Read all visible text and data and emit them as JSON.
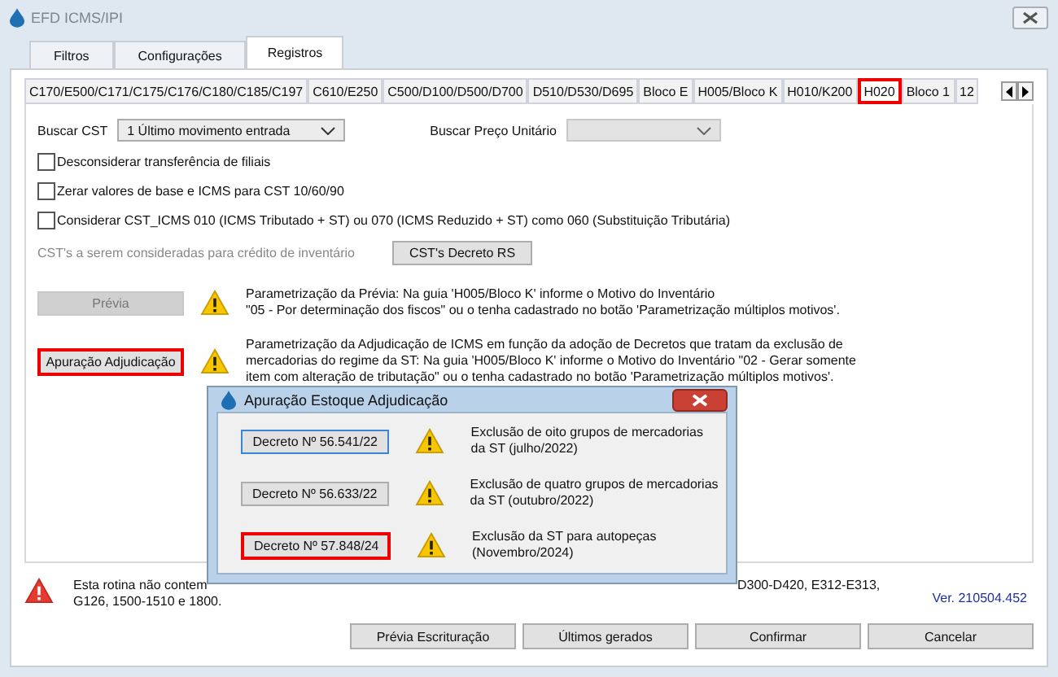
{
  "window": {
    "title": "EFD ICMS/IPI"
  },
  "tabs": [
    {
      "label": "Filtros",
      "selected": false
    },
    {
      "label": "Configurações",
      "selected": false
    },
    {
      "label": "Registros",
      "selected": true
    }
  ],
  "subtabs": [
    {
      "label": "C170/E500/C171/C175/C176/C180/C185/C197",
      "selected": false,
      "highlighted": false
    },
    {
      "label": "C610/E250",
      "selected": false,
      "highlighted": false
    },
    {
      "label": "C500/D100/D500/D700",
      "selected": false,
      "highlighted": false
    },
    {
      "label": "D510/D530/D695",
      "selected": false,
      "highlighted": false
    },
    {
      "label": "Bloco E",
      "selected": false,
      "highlighted": false
    },
    {
      "label": "H005/Bloco K",
      "selected": false,
      "highlighted": false
    },
    {
      "label": "H010/K200",
      "selected": false,
      "highlighted": false
    },
    {
      "label": "H020",
      "selected": true,
      "highlighted": true
    },
    {
      "label": "Bloco 1",
      "selected": false,
      "highlighted": false
    },
    {
      "label": "12",
      "selected": false,
      "highlighted": false
    }
  ],
  "buscar_cst": {
    "label": "Buscar CST",
    "value": "1 Último movimento entrada"
  },
  "buscar_preco": {
    "label": "Buscar Preço Unitário",
    "disabled": true
  },
  "checkboxes": [
    {
      "label": "Desconsiderar transferência de filiais",
      "checked": false
    },
    {
      "label": "Zerar valores de base e ICMS para CST 10/60/90",
      "checked": false
    },
    {
      "label": "Considerar CST_ICMS 010 (ICMS Tributado + ST) ou 070 (ICMS Reduzido + ST) como 060 (Substituição Tributária)",
      "checked": false
    }
  ],
  "cst_credito": {
    "label": "CST's a serem consideradas para crédito de inventário",
    "button": "CST's Decreto RS"
  },
  "actions": [
    {
      "button": "Prévia",
      "disabled": true,
      "highlighted": false,
      "lines": [
        "Parametrização da Prévia: Na guia 'H005/Bloco K' informe o Motivo do Inventário",
        "\"05 - Por determinação dos fiscos\" ou o tenha cadastrado no botão 'Parametrização múltiplos motivos'."
      ]
    },
    {
      "button": "Apuração Adjudicação",
      "disabled": false,
      "highlighted": true,
      "lines": [
        "Parametrização da Adjudicação de ICMS em função da adoção de Decretos que tratam da exclusão de",
        "mercadorias do regime da ST: Na guia 'H005/Bloco K' informe o Motivo do Inventário \"02 - Gerar somente",
        "item com alteração de tributação\" ou o tenha cadastrado no botão 'Parametrização múltiplos motivos'."
      ]
    }
  ],
  "dialog": {
    "title": "Apuração Estoque Adjudicação",
    "items": [
      {
        "button": "Decreto Nº 56.541/22",
        "focused": true,
        "highlighted": false,
        "lines": [
          "Exclusão de oito grupos de mercadorias",
          "da ST  (julho/2022)"
        ]
      },
      {
        "button": "Decreto Nº 56.633/22",
        "focused": false,
        "highlighted": false,
        "lines": [
          "Exclusão de quatro grupos de mercadorias",
          "da ST  (outubro/2022)"
        ]
      },
      {
        "button": "Decreto Nº 57.848/24",
        "focused": false,
        "highlighted": true,
        "lines": [
          "Exclusão da ST para autopeças",
          "(Novembro/2024)"
        ]
      }
    ]
  },
  "notice": {
    "line1_start": "Esta rotina não contem",
    "line1_end": "D300-D420, E312-E313,",
    "line2": "G126, 1500-1510 e 1800."
  },
  "version": "Ver. 210504.452",
  "footer_buttons": [
    "Prévia Escrituração",
    "Últimos gerados",
    "Confirmar",
    "Cancelar"
  ]
}
